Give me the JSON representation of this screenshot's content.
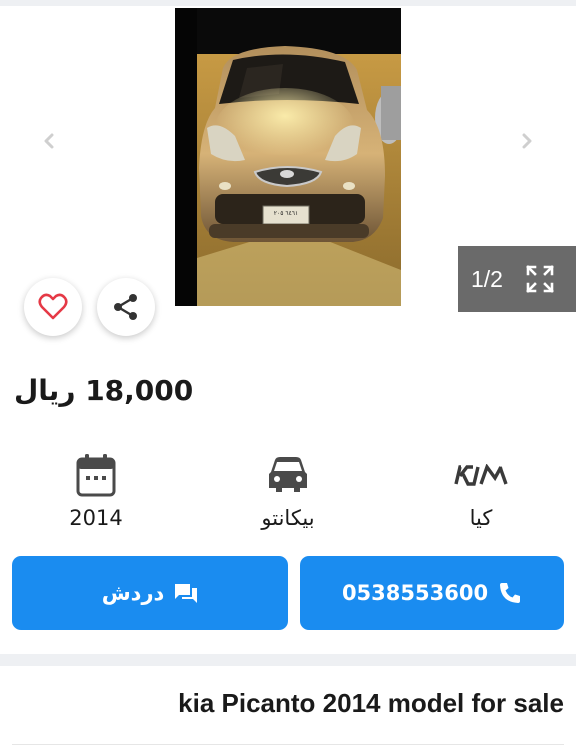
{
  "gallery": {
    "counter": "1/2",
    "plate_text": "٦٤٦١ ٢٠٥"
  },
  "listing": {
    "price": "18,000 ريال",
    "title": "kia Picanto 2014 model for sale"
  },
  "specs": {
    "year": "2014",
    "model": "بيكانتو",
    "make": "كيا"
  },
  "actions": {
    "chat_label": "دردش",
    "phone_label": "0538553600"
  },
  "icons": {
    "prev": "chevron-left-icon",
    "next": "chevron-right-icon",
    "fullscreen": "fullscreen-icon",
    "favorite": "heart-icon",
    "share": "share-icon",
    "year": "calendar-icon",
    "model": "car-icon",
    "make": "kia-logo-icon",
    "chat": "chat-icon",
    "phone": "phone-icon"
  },
  "colors": {
    "primary": "#1a8cf0",
    "heart": "#e53946",
    "counter_bg": "#6a6a6a"
  }
}
